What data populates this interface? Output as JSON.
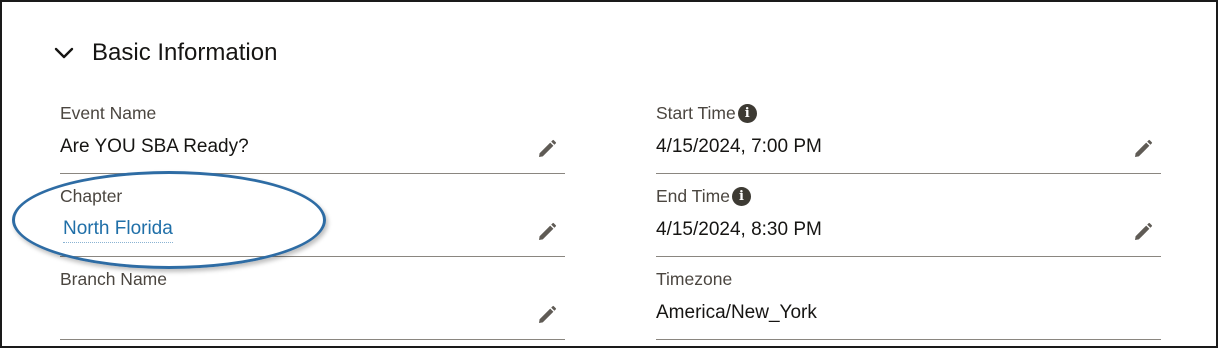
{
  "section": {
    "title": "Basic Information",
    "chevron_icon": "chevron-down-icon"
  },
  "fields_left": [
    {
      "label": "Event Name",
      "value": "Are YOU SBA Ready?"
    },
    {
      "label": "Chapter",
      "value": "North Florida"
    },
    {
      "label": "Branch Name",
      "value": ""
    }
  ],
  "fields_right": [
    {
      "label": "Start Time",
      "value": "4/15/2024, 7:00 PM",
      "info_icon": "i"
    },
    {
      "label": "End Time",
      "value": "4/15/2024, 8:30 PM",
      "info_icon": "i"
    },
    {
      "label": "Timezone",
      "value": "America/New_York"
    }
  ],
  "icons": {
    "edit": "pencil-icon",
    "info": "info-icon"
  },
  "colors": {
    "text": "#161513",
    "label": "#4b4640",
    "link": "#1f6fa8",
    "annotation": "#2e6ca4"
  }
}
